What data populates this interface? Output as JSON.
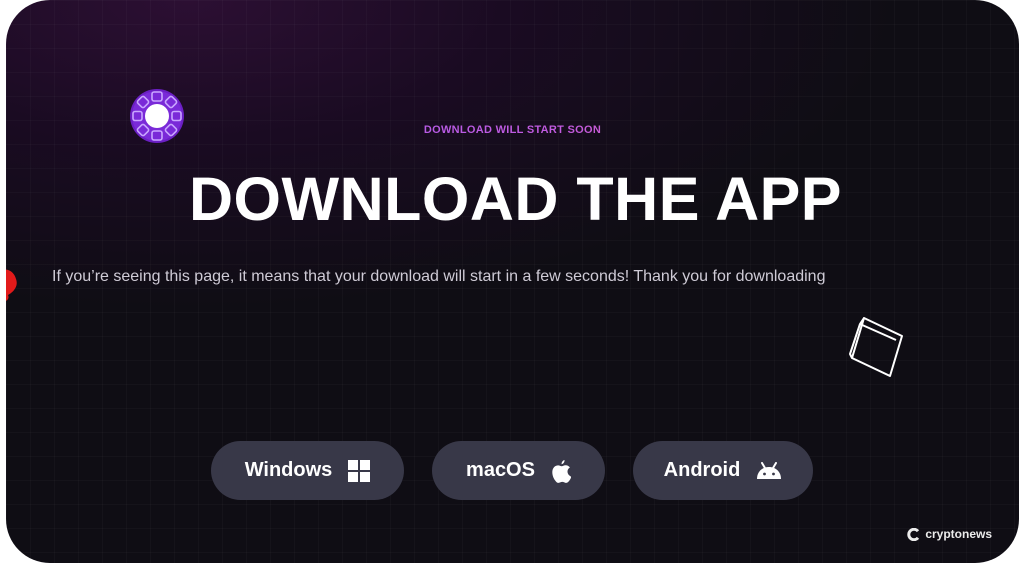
{
  "page": {
    "eyebrow": "DOWNLOAD WILL START SOON",
    "title": "DOWNLOAD THE APP",
    "subtitle": "If you’re seeing this page, it means that your download will start in a few seconds! Thank you for downloading"
  },
  "downloads": [
    {
      "label": "Windows",
      "icon": "windows-icon"
    },
    {
      "label": "macOS",
      "icon": "apple-icon"
    },
    {
      "label": "Android",
      "icon": "android-icon"
    }
  ],
  "watermark": {
    "text": "cryptonews"
  },
  "colors": {
    "background": "#0f0d14",
    "accent_purple": "#9b5cf6",
    "accent_red": "#ff5a6a",
    "button_bg": "#383848"
  }
}
